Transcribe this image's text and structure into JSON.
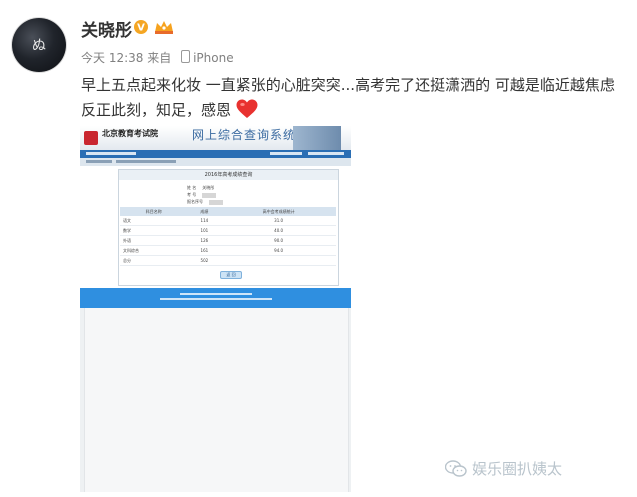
{
  "user": {
    "name": "关晓彤",
    "avatar_text": "ぬ"
  },
  "meta": {
    "time": "今天 12:38",
    "source_prefix": "来自",
    "source": "iPhone"
  },
  "post": {
    "line1": "早上五点起来化妆 一直紧张的心脏突突...高考完了还挺潇洒的 可越是临近越焦虑",
    "line2": "反正此刻，知足，感恩"
  },
  "embedded_screenshot": {
    "site_name": "北京教育考试院",
    "system_title": "网上综合查询系统",
    "panel_title": "2016年高考成绩查询",
    "fields": [
      {
        "label": "姓 名",
        "value": "关晓彤"
      },
      {
        "label": "考 号",
        "value": ""
      },
      {
        "label": "报名序号",
        "value": ""
      }
    ],
    "table": {
      "headers": [
        "科目名称",
        "成绩",
        "高中会考成绩统计"
      ],
      "rows": [
        {
          "subject": "语文",
          "score": "114",
          "extra": "31.0"
        },
        {
          "subject": "数学",
          "score": "101",
          "extra": "40.0"
        },
        {
          "subject": "外语",
          "score": "126",
          "extra": "90.0"
        },
        {
          "subject": "文科综合",
          "score": "161",
          "extra": "94.0"
        },
        {
          "subject": "总分",
          "score": "502",
          "extra": ""
        }
      ]
    },
    "back_button": "返 回"
  },
  "watermark": {
    "text": "娱乐圈扒姨太"
  },
  "colors": {
    "vip_badge": "#f5a623",
    "heart": "#e8312f",
    "nav_blue": "#2a6eb4",
    "footer_blue": "#2f8fe0"
  }
}
